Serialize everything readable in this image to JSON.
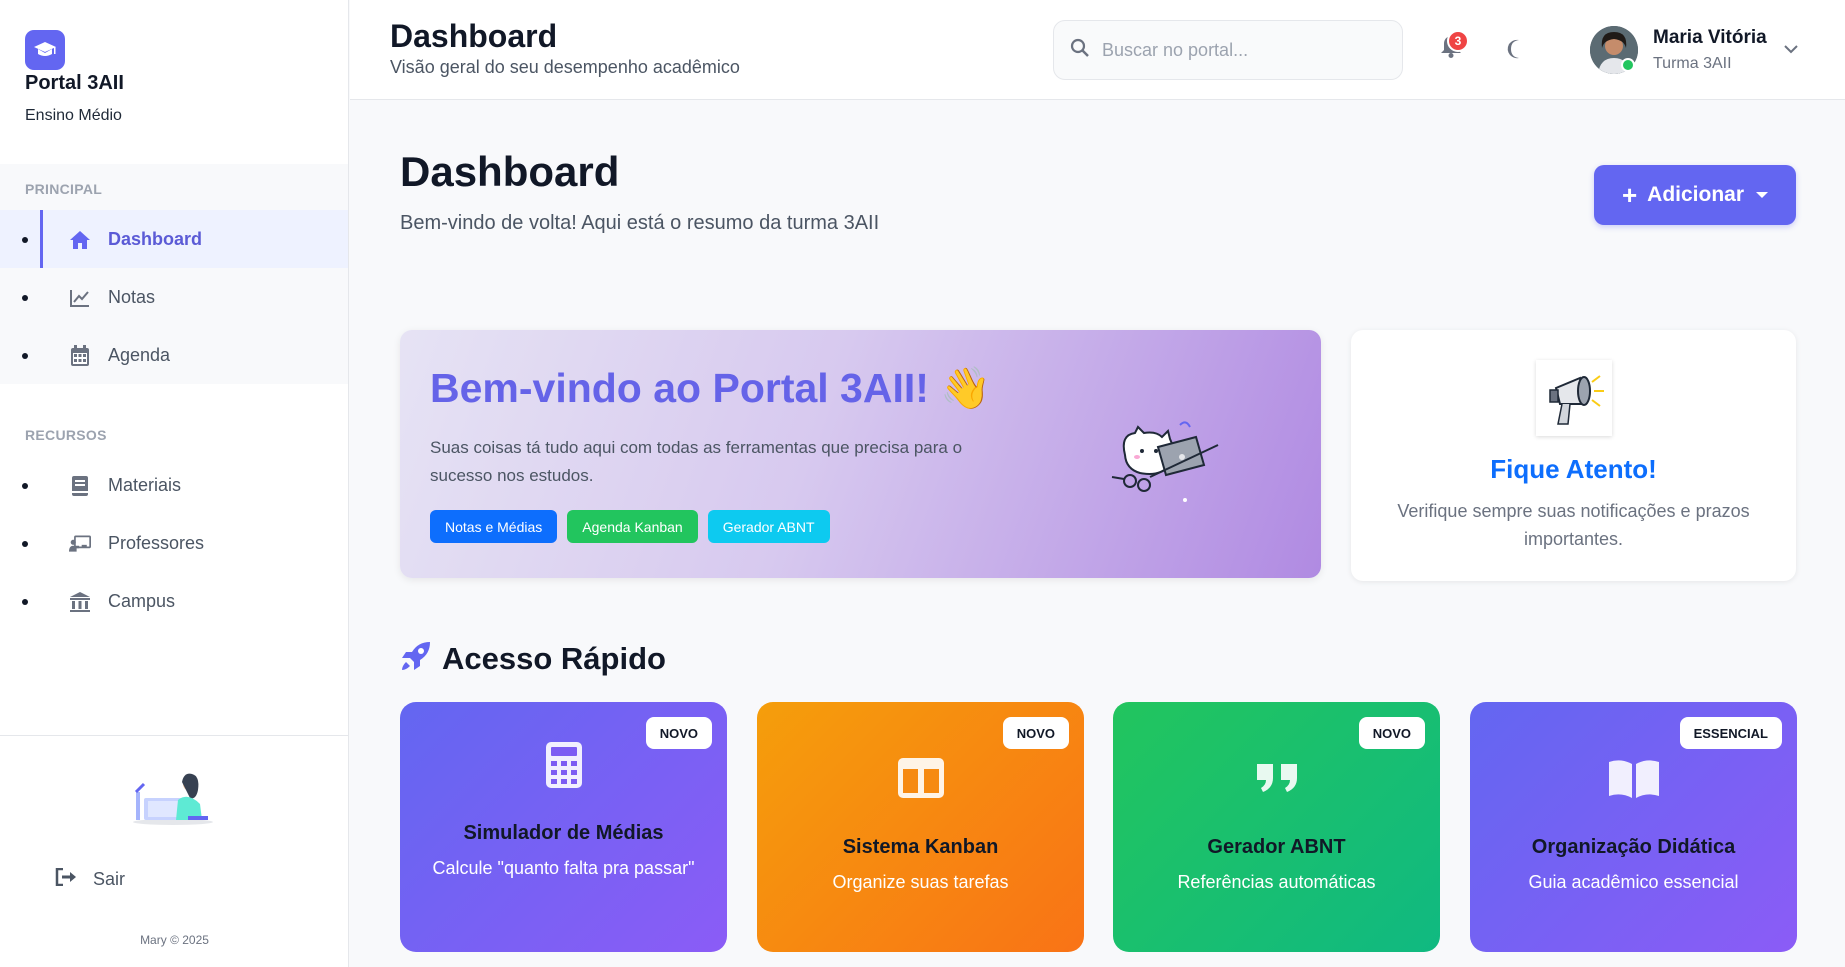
{
  "sidebar": {
    "brand_title": "Portal 3AII",
    "brand_sub": "Ensino Médio",
    "section_principal": "PRINCIPAL",
    "section_recursos": "RECURSOS",
    "items_principal": [
      {
        "label": "Dashboard",
        "icon": "home-icon",
        "active": true
      },
      {
        "label": "Notas",
        "icon": "chart-line-icon",
        "active": false
      },
      {
        "label": "Agenda",
        "icon": "calendar-icon",
        "active": false
      }
    ],
    "items_recursos": [
      {
        "label": "Materiais",
        "icon": "book-icon"
      },
      {
        "label": "Professores",
        "icon": "chalkboard-teacher-icon"
      },
      {
        "label": "Campus",
        "icon": "university-icon"
      }
    ],
    "logout_label": "Sair",
    "copyright": "Mary © 2025"
  },
  "topbar": {
    "title": "Dashboard",
    "subtitle": "Visão geral do seu desempenho acadêmico",
    "search_placeholder": "Buscar no portal...",
    "notification_count": "3",
    "user_name": "Maria Vitória",
    "user_class": "Turma 3AII"
  },
  "main": {
    "title": "Dashboard",
    "subtitle": "Bem-vindo de volta! Aqui está o resumo da turma 3AII",
    "add_button": "Adicionar",
    "welcome": {
      "title": "Bem-vindo ao Portal 3AII! 👋",
      "text": "Suas coisas tá tudo aqui com todas as ferramentas que precisa para o sucesso nos estudos.",
      "tags": [
        {
          "label": "Notas e Médias",
          "color": "#0d6efd"
        },
        {
          "label": "Agenda Kanban",
          "color": "#22c55e"
        },
        {
          "label": "Gerador ABNT",
          "color": "#0dcaf0"
        }
      ]
    },
    "notice": {
      "title": "Fique Atento!",
      "text": "Verifique sempre suas notificações e prazos importantes."
    },
    "quick_access_title": "Acesso Rápido",
    "cards": [
      {
        "badge": "NOVO",
        "title": "Simulador de Médias",
        "desc": "Calcule \"quanto falta pra passar\"",
        "icon": "calculator-icon"
      },
      {
        "badge": "NOVO",
        "title": "Sistema Kanban",
        "desc": "Organize suas tarefas",
        "icon": "columns-icon"
      },
      {
        "badge": "NOVO",
        "title": "Gerador ABNT",
        "desc": "Referências automáticas",
        "icon": "quote-icon"
      },
      {
        "badge": "ESSENCIAL",
        "title": "Organização Didática",
        "desc": "Guia acadêmico essencial",
        "icon": "open-book-icon"
      }
    ]
  },
  "colors": {
    "accent": "#6366f1",
    "notice_title": "#0d6efd",
    "badge": "#ef4444"
  }
}
